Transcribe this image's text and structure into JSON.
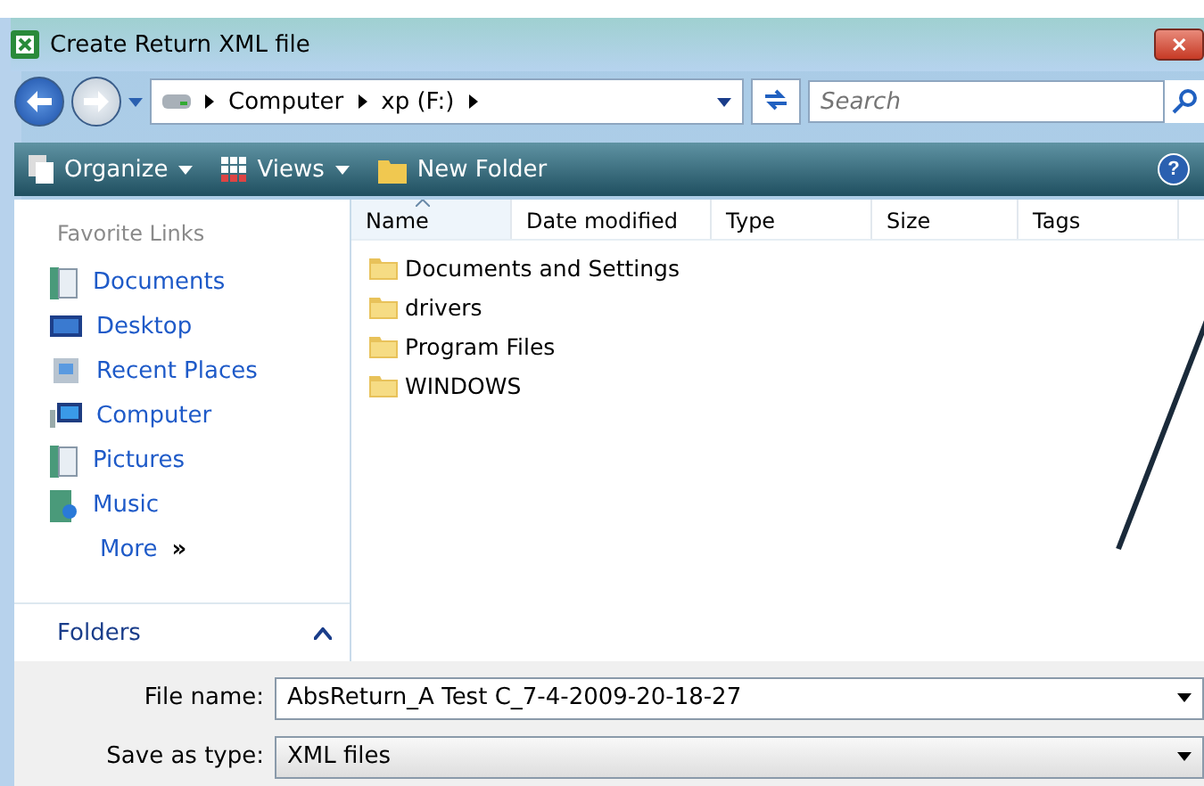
{
  "window": {
    "title": "Create Return XML file",
    "close_label": "✕"
  },
  "address": {
    "crumbs": [
      "Computer",
      "xp (F:)"
    ],
    "search_placeholder": "Search"
  },
  "toolbar": {
    "items": [
      {
        "label": "Organize",
        "kind": "menu"
      },
      {
        "label": "Views",
        "kind": "menu"
      },
      {
        "label": "New Folder",
        "kind": "plain"
      }
    ],
    "help": "?"
  },
  "sidebar": {
    "heading": "Favorite Links",
    "links": [
      {
        "label": "Documents",
        "kind": "docs"
      },
      {
        "label": "Desktop",
        "kind": "desktop"
      },
      {
        "label": "Recent Places",
        "kind": "recent"
      },
      {
        "label": "Computer",
        "kind": "computer"
      },
      {
        "label": "Pictures",
        "kind": "docs"
      },
      {
        "label": "Music",
        "kind": "music"
      }
    ],
    "more": "More",
    "more_mark": "»",
    "folders": "Folders",
    "folders_expanded": true
  },
  "table": {
    "columns": [
      {
        "label": "Name",
        "sorted": true
      },
      {
        "label": "Date modified",
        "sorted": false
      },
      {
        "label": "Type",
        "sorted": false
      },
      {
        "label": "Size",
        "sorted": false
      },
      {
        "label": "Tags",
        "sorted": false
      }
    ],
    "rows": [
      "Documents and Settings",
      "drivers",
      "Program Files",
      "WINDOWS"
    ]
  },
  "form": {
    "file_name_label": "File name:",
    "file_name": "AbsReturn_A Test C_7-4-2009-20-18-27",
    "type_label": "Save as type:",
    "type": "XML files"
  }
}
